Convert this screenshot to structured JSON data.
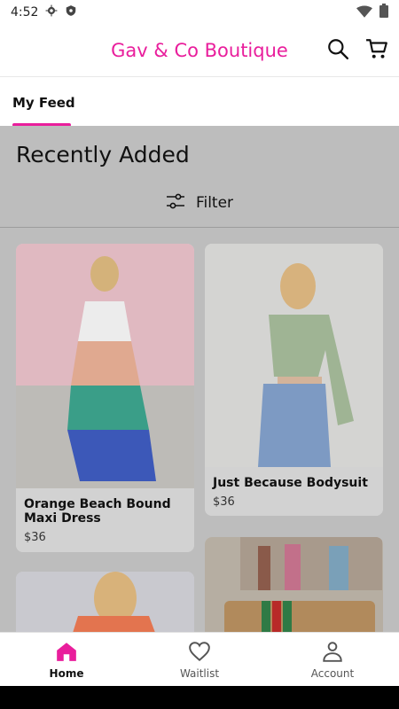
{
  "status_bar": {
    "time": "4:52",
    "icons": [
      "settings-gear-icon",
      "shield-app-icon",
      "wifi-icon",
      "battery-icon"
    ]
  },
  "header": {
    "title": "Gav & Co Boutique",
    "icons": [
      "search-icon",
      "cart-icon"
    ],
    "brand_color": "#e91e9c"
  },
  "tabs": [
    {
      "label": "My Feed",
      "active": true
    }
  ],
  "feed": {
    "section_title": "Recently Added",
    "filter_label": "Filter",
    "products": [
      {
        "title": "Orange Beach Bound Maxi Dress",
        "price": "$36"
      },
      {
        "title": "Just Because Bodysuit",
        "price": "$36"
      },
      {
        "title": "",
        "price": ""
      },
      {
        "title": "",
        "price": ""
      }
    ]
  },
  "bottom_nav": {
    "items": [
      {
        "label": "Home",
        "icon": "home-icon",
        "active": true
      },
      {
        "label": "Waitlist",
        "icon": "heart-icon",
        "active": false
      },
      {
        "label": "Account",
        "icon": "account-icon",
        "active": false
      }
    ],
    "active_color": "#e91e9c"
  }
}
